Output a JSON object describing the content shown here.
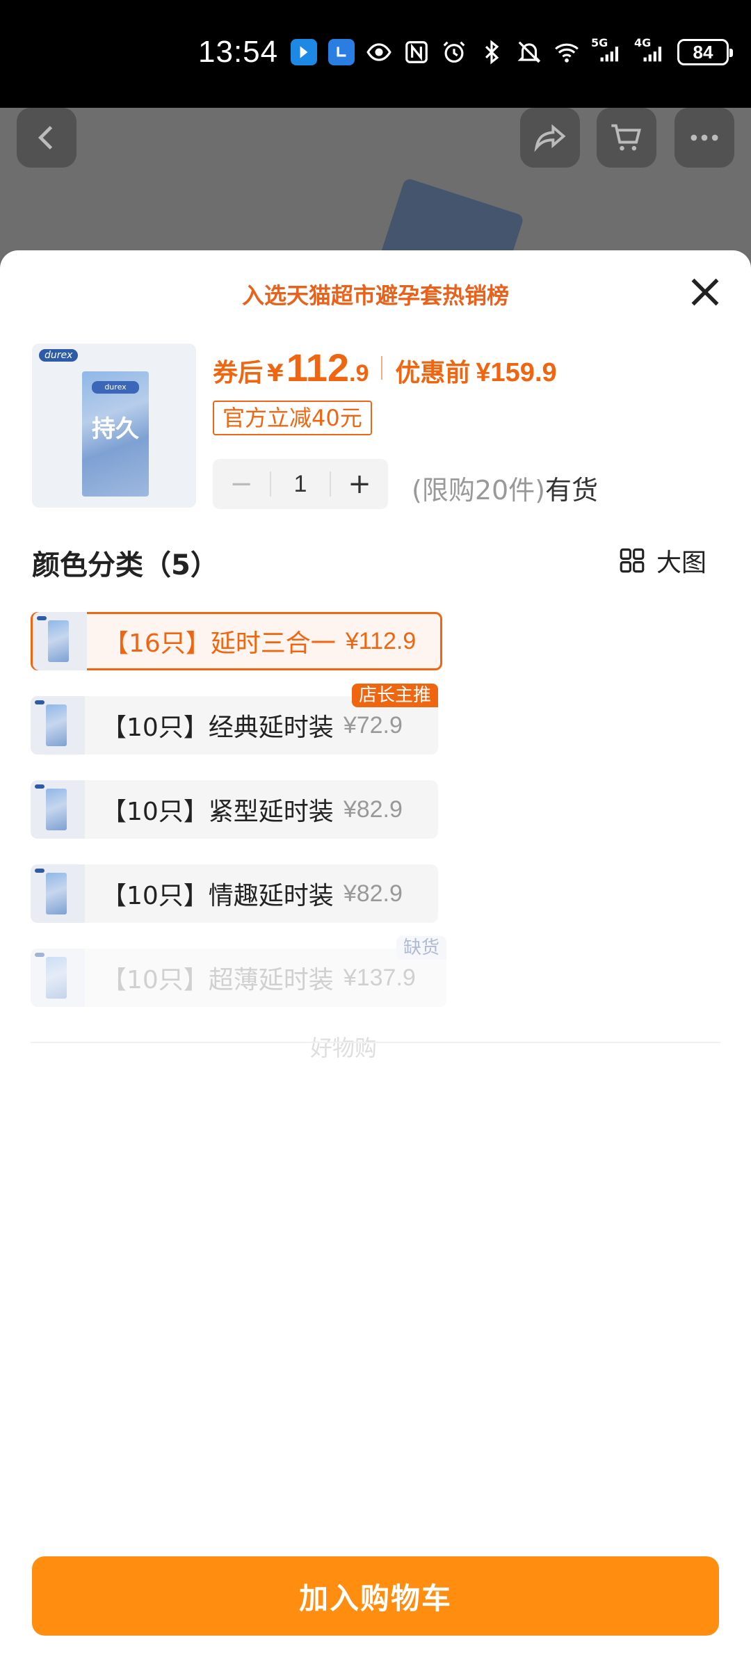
{
  "status_bar": {
    "time": "13:54",
    "net1": "5G",
    "net2": "4G",
    "battery": "84"
  },
  "sheet": {
    "rank_title": "入选天猫超市避孕套热销榜",
    "product_brand": "durex",
    "product_box_label": "durex",
    "product_box_big": "持久",
    "price": {
      "label": "券后",
      "yen": "¥",
      "integer": "112",
      "decimal": ".9",
      "orig_label": "优惠前",
      "orig_price": "¥159.9"
    },
    "discount_tag": "官方立减40元",
    "stepper": {
      "minus": "−",
      "value": "1",
      "plus": "+"
    },
    "stock_limit": "(限购20件)",
    "stock_status": "有货",
    "section_title": "颜色分类（5）",
    "big_pic_label": "大图",
    "variants": [
      {
        "name": "【16只】延时三合一",
        "price": "¥112.9"
      },
      {
        "name": "【10只】经典延时装",
        "price": "¥72.9",
        "tag": "店长主推"
      },
      {
        "name": "【10只】紧型延时装",
        "price": "¥82.9"
      },
      {
        "name": "【10只】情趣延时装",
        "price": "¥82.9"
      },
      {
        "name": "【10只】超薄延时装",
        "price": "¥137.9",
        "tag": "缺货"
      }
    ],
    "watermark": "好物购",
    "add_to_cart": "加入购物车"
  },
  "colors": {
    "accent": "#f0650f",
    "button": "#ff8e10"
  }
}
